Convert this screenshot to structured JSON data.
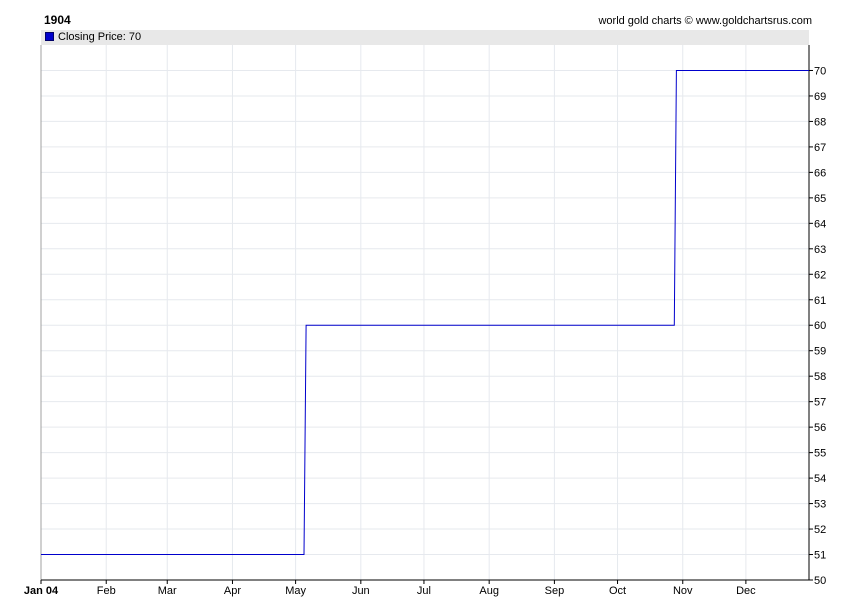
{
  "header": {
    "title": "1904",
    "credit": "world gold charts © www.goldchartsrus.com"
  },
  "legend": {
    "label": "Closing Price: 70",
    "color": "#0000cc"
  },
  "chart_data": {
    "type": "line",
    "step": true,
    "title": "1904",
    "series": [
      {
        "name": "Closing Price",
        "color": "#0000cc",
        "x": [
          "1904-01-01",
          "1904-05-05",
          "1904-05-06",
          "1904-10-28",
          "1904-10-29",
          "1904-12-31"
        ],
        "y": [
          51,
          51,
          60,
          60,
          70,
          70
        ]
      }
    ],
    "x_ticks": [
      "Jan 04",
      "Feb",
      "Mar",
      "Apr",
      "May",
      "Jun",
      "Jul",
      "Aug",
      "Sep",
      "Oct",
      "Nov",
      "Dec"
    ],
    "y_ticks": [
      "70",
      "69",
      "68",
      "67",
      "66",
      "65",
      "64",
      "63",
      "62",
      "61",
      "60",
      "59",
      "58",
      "57",
      "56",
      "55",
      "54",
      "53",
      "52",
      "51",
      "50"
    ],
    "ylim": [
      50,
      70
    ],
    "y_axis_position": "right",
    "grid": true
  }
}
